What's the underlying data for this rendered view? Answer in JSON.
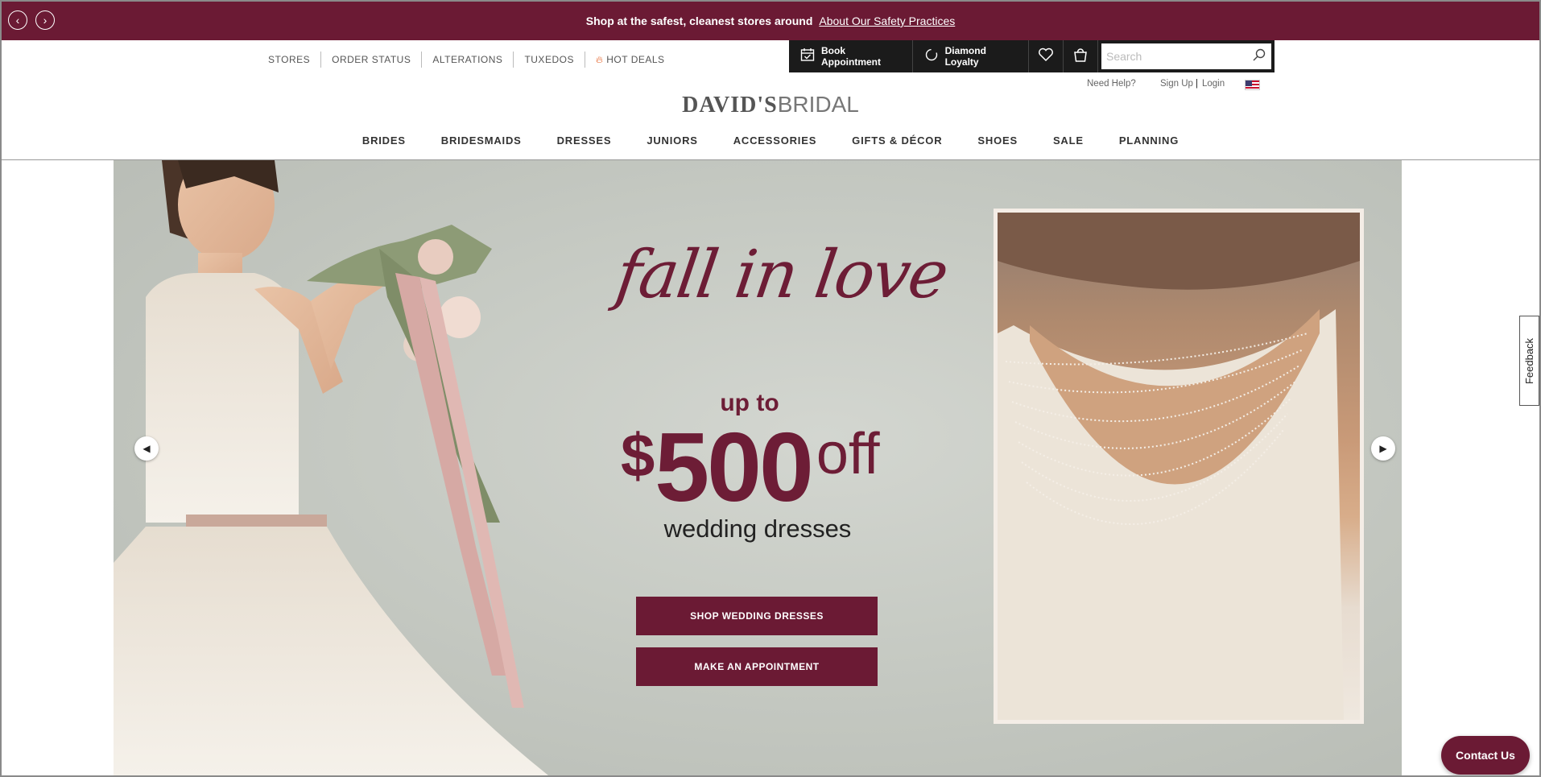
{
  "browser": {
    "back_icon": "chevron-left-icon",
    "forward_icon": "chevron-right-icon"
  },
  "promo": {
    "message": "Shop at the safest, cleanest stores around",
    "link": "About Our Safety Practices"
  },
  "utility_nav": [
    {
      "label": "STORES"
    },
    {
      "label": "ORDER STATUS"
    },
    {
      "label": "ALTERATIONS"
    },
    {
      "label": "TUXEDOS"
    },
    {
      "label": "HOT DEALS",
      "icon": "fire-icon"
    }
  ],
  "actions": {
    "book_appointment": "Book Appointment",
    "diamond_loyalty": "Diamond Loyalty",
    "wishlist_icon": "heart-icon",
    "bag_icon": "shopping-bag-icon",
    "search_placeholder": "Search"
  },
  "account": {
    "help": "Need Help?",
    "signup": "Sign Up",
    "divider": "|",
    "login": "Login",
    "flag": "us-flag-icon"
  },
  "logo": {
    "part1": "DAVID'S",
    "part2": "BRIDAL"
  },
  "main_nav": [
    "BRIDES",
    "BRIDESMAIDS",
    "DRESSES",
    "JUNIORS",
    "ACCESSORIES",
    "GIFTS & DÉCOR",
    "SHOES",
    "SALE",
    "PLANNING"
  ],
  "hero": {
    "script_text": "fall in love",
    "up_to": "up to",
    "currency": "$",
    "amount": "500",
    "off": "off",
    "subtitle": "wedding dresses",
    "cta_primary": "SHOP WEDDING DRESSES",
    "cta_secondary": "MAKE AN APPOINTMENT"
  },
  "feedback": "Feedback",
  "contact": "Contact Us",
  "colors": {
    "brand": "#6b1a34",
    "actionbar": "#1b1b1b"
  }
}
